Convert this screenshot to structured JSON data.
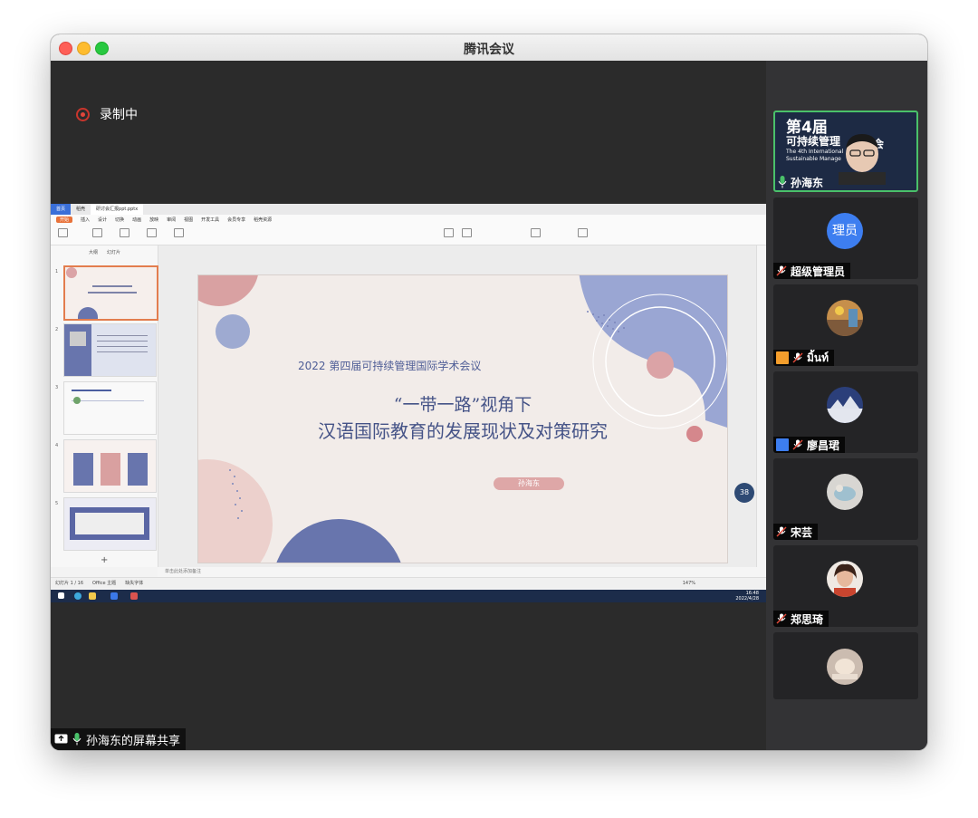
{
  "window": {
    "title": "腾讯会议"
  },
  "recording": {
    "label": "录制中"
  },
  "share": {
    "label": "孙海东的屏幕共享"
  },
  "wps": {
    "tabs": [
      "首页",
      "稻壳",
      "研讨会汇报ppt.pptx"
    ],
    "menu": [
      "开始",
      "插入",
      "设计",
      "切换",
      "动画",
      "放映",
      "审阅",
      "视图",
      "开发工具",
      "会员专享",
      "稻壳资源"
    ],
    "thumb_tabs": [
      "大纲",
      "幻灯片"
    ],
    "slide_count": "幻灯片 1 / 16",
    "theme": "Office 主题",
    "missing_font": "缺失字体",
    "notes_placeholder": "单击此处添加备注",
    "zoom": "147%",
    "clock_time": "16:48",
    "clock_date": "2022/4/28",
    "badge": "38"
  },
  "slide": {
    "subtitle": "2022 第四届可持续管理国际学术会议",
    "title_line1": "“一带一路”视角下",
    "title_line2": "汉语国际教育的发展现状及对策研究",
    "author": "孙海东"
  },
  "participants": [
    {
      "name": "孙海东",
      "mic": "on",
      "speaking": true,
      "banner_l1": "第4届",
      "banner_l2": "可持续管理",
      "banner_suffix": "会",
      "banner_en1": "The 4th International",
      "banner_en2": "Sustainable Manage"
    },
    {
      "name": "超级管理员",
      "mic": "off",
      "avatar_text": "理员",
      "avatar_color": "#3d7ef0"
    },
    {
      "name": "มิ้นท์",
      "mic": "off"
    },
    {
      "name": "廖昌珺",
      "mic": "off"
    },
    {
      "name": "宋芸",
      "mic": "off"
    },
    {
      "name": "郑思琦",
      "mic": "off"
    }
  ],
  "colors": {
    "accent_blue": "#3d7ef0",
    "speaking_green": "#4ac16a",
    "record_red": "#c9352c",
    "slide_navy": "#455387",
    "slide_pink": "#d6a3a3"
  },
  "icons": [
    "record-icon",
    "screen-share-icon",
    "mic-on-icon",
    "mic-off-icon",
    "user-icon"
  ]
}
